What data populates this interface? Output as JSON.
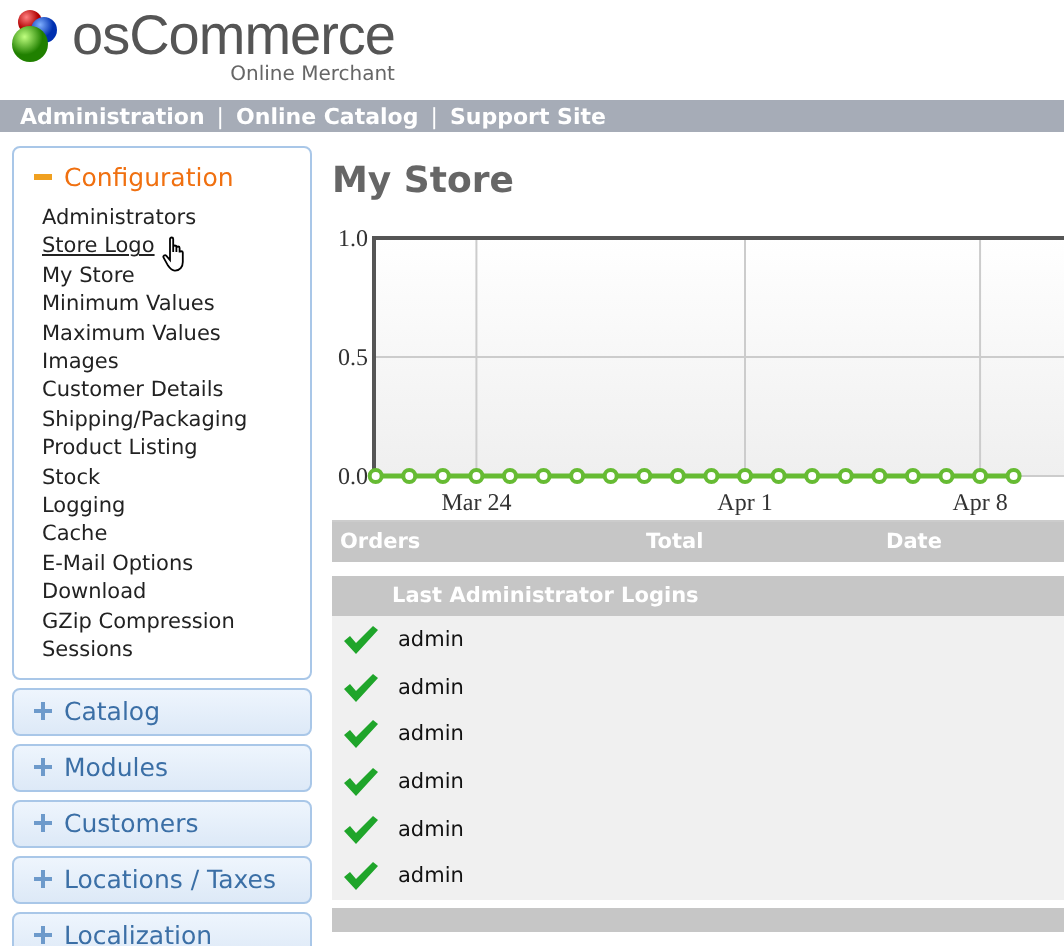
{
  "header": {
    "logo": "osCommerce",
    "tagline": "Online Merchant"
  },
  "nav": [
    {
      "kind": "link",
      "text": "Administration"
    },
    {
      "kind": "separator",
      "text": "|"
    },
    {
      "kind": "link",
      "text": "Online Catalog"
    },
    {
      "kind": "separator",
      "text": "|"
    },
    {
      "kind": "link",
      "text": "Support Site"
    }
  ],
  "sidebar": [
    {
      "title": "Configuration",
      "expanded": true,
      "items": [
        {
          "label": "Administrators",
          "hovered": false
        },
        {
          "label": "Store Logo",
          "hovered": true
        },
        {
          "label": "My Store",
          "hovered": false
        },
        {
          "label": "Minimum Values",
          "hovered": false
        },
        {
          "label": "Maximum Values",
          "hovered": false
        },
        {
          "label": "Images",
          "hovered": false
        },
        {
          "label": "Customer Details",
          "hovered": false
        },
        {
          "label": "Shipping/Packaging",
          "hovered": false
        },
        {
          "label": "Product Listing",
          "hovered": false
        },
        {
          "label": "Stock",
          "hovered": false
        },
        {
          "label": "Logging",
          "hovered": false
        },
        {
          "label": "Cache",
          "hovered": false
        },
        {
          "label": "E-Mail Options",
          "hovered": false
        },
        {
          "label": "Download",
          "hovered": false
        },
        {
          "label": "GZip Compression",
          "hovered": false
        },
        {
          "label": "Sessions",
          "hovered": false
        }
      ]
    },
    {
      "title": "Catalog",
      "expanded": false
    },
    {
      "title": "Modules",
      "expanded": false
    },
    {
      "title": "Customers",
      "expanded": false
    },
    {
      "title": "Locations / Taxes",
      "expanded": false
    },
    {
      "title": "Localization",
      "expanded": false
    }
  ],
  "main": {
    "title": "My Store",
    "chart_data": {
      "type": "line",
      "categories": [
        null,
        null,
        null,
        "Mar 24",
        null,
        null,
        null,
        null,
        null,
        null,
        null,
        "Apr 1",
        null,
        null,
        null,
        null,
        null,
        null,
        "Apr 8",
        null
      ],
      "grid": true,
      "series": [
        {
          "color": "#66bb33",
          "marker": "circle",
          "values": [
            0,
            0,
            0,
            0,
            0,
            0,
            0,
            0,
            0,
            0,
            0,
            0,
            0,
            0,
            0,
            0,
            0,
            0,
            0,
            0
          ]
        }
      ],
      "ylim": [
        0,
        1
      ],
      "yticks": [
        {
          "value": 0,
          "label": "0.0"
        },
        {
          "value": 0.5,
          "label": "0.5"
        },
        {
          "value": 1,
          "label": "1.0"
        }
      ]
    },
    "orders_table": {
      "columns": [
        "Orders",
        "Total",
        "Date"
      ]
    },
    "logins": {
      "title": "Last Administrator Logins",
      "rows": [
        {
          "user": "admin",
          "success": true
        },
        {
          "user": "admin",
          "success": true
        },
        {
          "user": "admin",
          "success": true
        },
        {
          "user": "admin",
          "success": true
        },
        {
          "user": "admin",
          "success": true
        },
        {
          "user": "admin",
          "success": true
        }
      ]
    }
  }
}
